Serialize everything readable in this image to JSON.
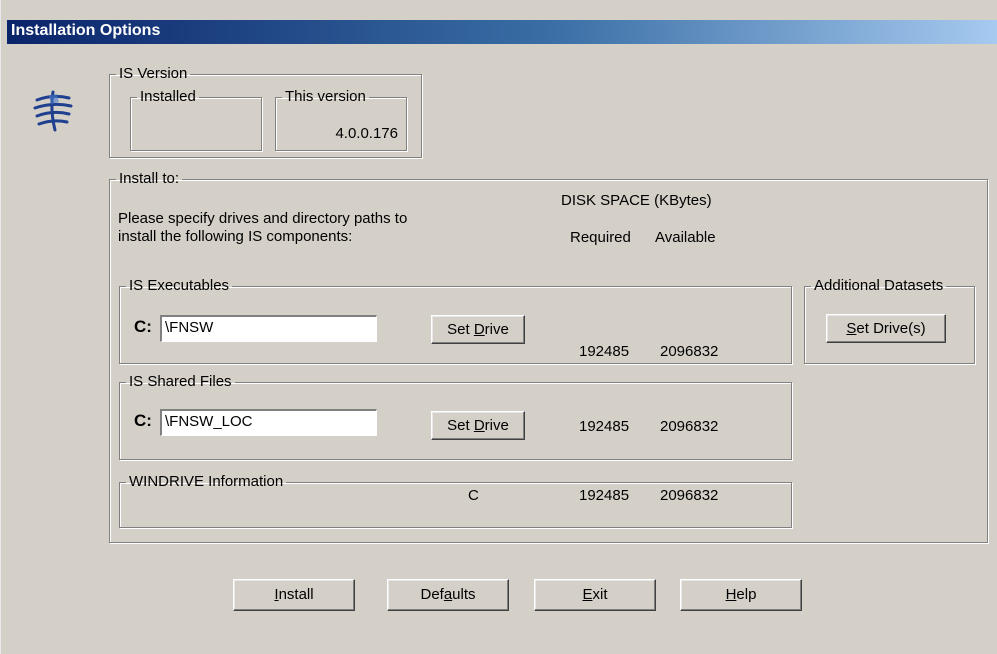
{
  "window": {
    "title": "Installation Options"
  },
  "is_version": {
    "group_label": "IS Version",
    "installed_label": "Installed",
    "installed_value": "",
    "this_version_label": "This version",
    "this_version_value": "4.0.0.176"
  },
  "install_to": {
    "group_label": "Install to:",
    "instructions_line1": "Please specify drives and directory paths to",
    "instructions_line2": "install the following IS components:",
    "disk_space_header": "DISK SPACE (KBytes)",
    "required_header": "Required",
    "available_header": "Available",
    "executables": {
      "label": "IS Executables",
      "drive": "C:",
      "path": "\\FNSW",
      "button_pre": "Set ",
      "button_key": "D",
      "button_post": "rive",
      "required": "192485",
      "available": "2096832"
    },
    "shared_files": {
      "label": "IS Shared Files",
      "drive": "C:",
      "path": "\\FNSW_LOC",
      "button_pre": "Set ",
      "button_key": "D",
      "button_post": "rive",
      "required": "192485",
      "available": "2096832"
    },
    "windrive": {
      "label": "WINDRIVE Information",
      "drive": "C",
      "required": "192485",
      "available": "2096832"
    }
  },
  "additional_datasets": {
    "label": "Additional Datasets",
    "button_pre": "",
    "button_key": "S",
    "button_post": "et Drive(s)"
  },
  "buttons": {
    "install": {
      "pre": "",
      "key": "I",
      "post": "nstall"
    },
    "defaults": {
      "pre": "Def",
      "key": "a",
      "post": "ults"
    },
    "exit": {
      "pre": "",
      "key": "E",
      "post": "xit"
    },
    "help": {
      "pre": "",
      "key": "H",
      "post": "elp"
    }
  },
  "icons": {
    "app": "filenet-logo-icon"
  }
}
